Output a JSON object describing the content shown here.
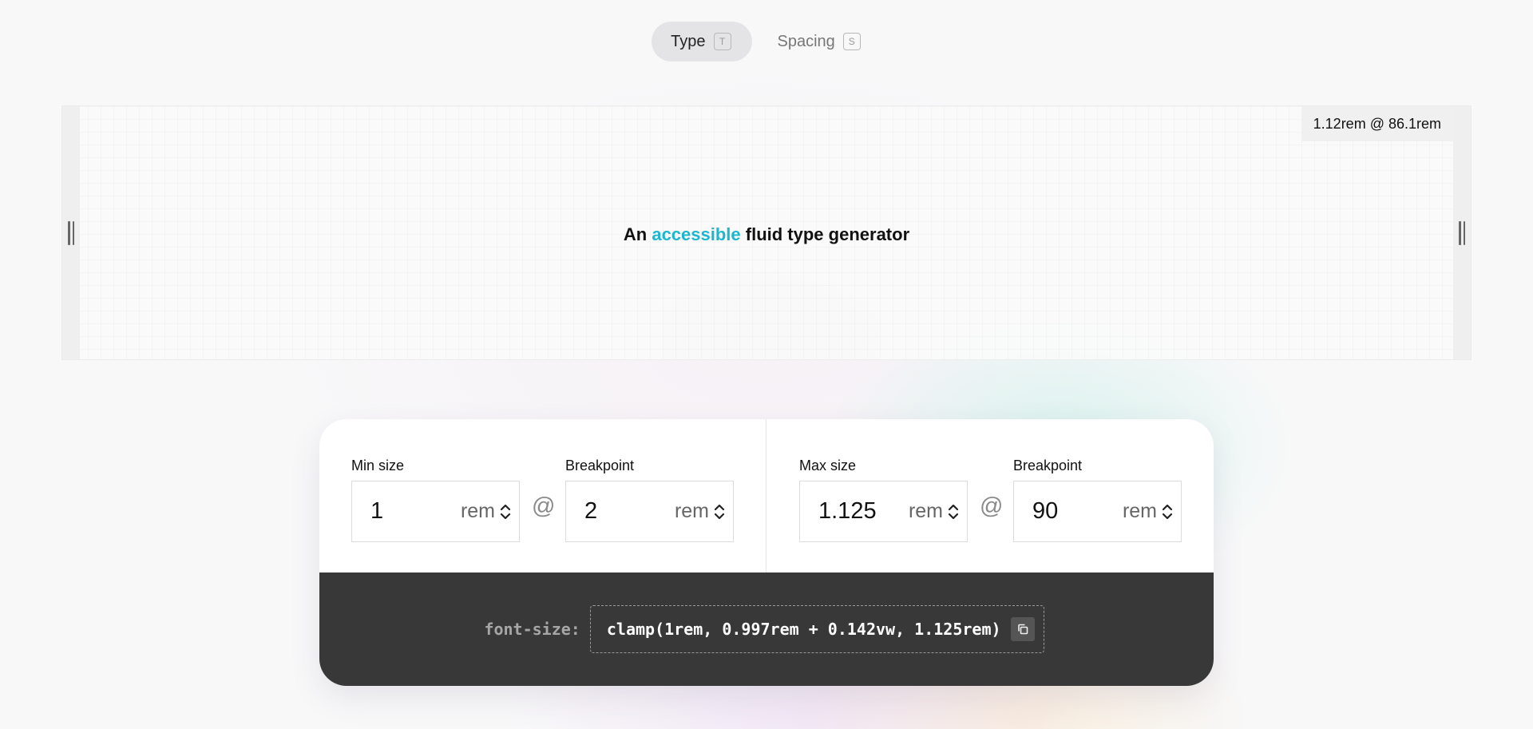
{
  "tabs": [
    {
      "label": "Type",
      "shortcut": "T",
      "active": true
    },
    {
      "label": "Spacing",
      "shortcut": "S",
      "active": false
    }
  ],
  "preview": {
    "size_readout": "1.12rem @ 86.1rem",
    "text_before": "An",
    "text_accent": "accessible",
    "text_after": "fluid type generator",
    "accent_color": "#1bb7cf"
  },
  "controls": {
    "min": {
      "size_label": "Min size",
      "size_value": "1",
      "size_unit": "rem",
      "at": "@",
      "breakpoint_label": "Breakpoint",
      "breakpoint_value": "2",
      "breakpoint_unit": "rem"
    },
    "max": {
      "size_label": "Max size",
      "size_value": "1.125",
      "size_unit": "rem",
      "at": "@",
      "breakpoint_label": "Breakpoint",
      "breakpoint_value": "90",
      "breakpoint_unit": "rem"
    }
  },
  "output": {
    "property": "font-size:",
    "value": "clamp(1rem, 0.997rem + 0.142vw, 1.125rem)"
  },
  "icons": {
    "resize_handle": "grip-vertical-icon",
    "stepper": "chevron-up-down-icon",
    "copy": "copy-icon"
  }
}
